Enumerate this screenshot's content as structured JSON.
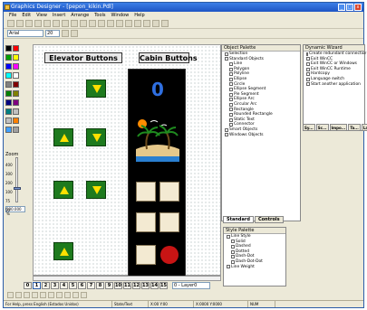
{
  "window": {
    "title": "Graphics Designer - [pepon_kikin.Pdl]",
    "controls": [
      "_",
      "□",
      "x"
    ]
  },
  "menu": [
    "File",
    "Edit",
    "View",
    "Insert",
    "Arrange",
    "Tools",
    "Window",
    "Help"
  ],
  "font_bar": {
    "font": "Arial",
    "size": "20"
  },
  "canvas": {
    "elevator_header": "Elevator Buttons",
    "cabin_header": "Cabin Buttons",
    "cabin_floor_indicator": "0"
  },
  "zoom": {
    "ticks": [
      "400",
      "300",
      "200",
      "100",
      "75",
      "50"
    ],
    "value": "100.000 %",
    "label": "Zoom"
  },
  "layers": {
    "tabs": [
      "0",
      "1",
      "2",
      "3",
      "4",
      "5",
      "6",
      "7",
      "8",
      "9",
      "10",
      "11",
      "12",
      "13",
      "14",
      "15"
    ],
    "combo": "0 - Layer0"
  },
  "object_palette": {
    "title": "Object Palette",
    "items": [
      {
        "label": "Selection",
        "level": 0
      },
      {
        "label": "Standard Objects",
        "level": 0
      },
      {
        "label": "Line",
        "level": 1
      },
      {
        "label": "Polygon",
        "level": 1
      },
      {
        "label": "Polyline",
        "level": 1
      },
      {
        "label": "Ellipse",
        "level": 1
      },
      {
        "label": "Circle",
        "level": 1
      },
      {
        "label": "Ellipse Segment",
        "level": 1
      },
      {
        "label": "Pie Segment",
        "level": 1
      },
      {
        "label": "Ellipse Arc",
        "level": 1
      },
      {
        "label": "Circular Arc",
        "level": 1
      },
      {
        "label": "Rectangle",
        "level": 1
      },
      {
        "label": "Rounded Rectangle",
        "level": 1
      },
      {
        "label": "Static Text",
        "level": 1
      },
      {
        "label": "Connector",
        "level": 1
      },
      {
        "label": "Smart Objects",
        "level": 0
      },
      {
        "label": "Windows Objects",
        "level": 0
      }
    ],
    "tabs": [
      "Standard",
      "Controls"
    ]
  },
  "dynamic_wizard": {
    "title": "Dynamic Wizard",
    "items": [
      "Create redundant connectior",
      "Exit WinCC",
      "Exit WinCC or Windows",
      "Exit WinCC Runtime",
      "Hardcopy",
      "Language switch",
      "Start another application"
    ],
    "tabs": [
      "Sy...",
      "Sc...",
      "Impo...",
      "Ta...",
      "Labl..."
    ]
  },
  "style_palette": {
    "title": "Style Palette",
    "items": [
      {
        "label": "Line Style",
        "level": 0
      },
      {
        "label": "Solid",
        "level": 1
      },
      {
        "label": "Dashed",
        "level": 1
      },
      {
        "label": "Dotted",
        "level": 1
      },
      {
        "label": "Dash-Dot",
        "level": 1
      },
      {
        "label": "Dash-Dot-Dot",
        "level": 1
      },
      {
        "label": "Line Weight",
        "level": 0
      }
    ]
  },
  "status": [
    "For Help, press  English (Estados Unidos)",
    "State/Text",
    "X:00  Y:00",
    "X:0000 Y:0000",
    "NUM"
  ],
  "colors": {
    "elevator_button": "#1e7a1e",
    "arrow": "#ffe000",
    "cabin_bg": "#000000",
    "floor_indicator": "#2f6fe0",
    "alarm": "#c81414",
    "titlebar": "#1d55c4"
  },
  "palette_colors": [
    "#000000",
    "#ff0000",
    "#00a000",
    "#ffff00",
    "#0000ff",
    "#ff00ff",
    "#00ffff",
    "#ffffff",
    "#808080",
    "#800000",
    "#008000",
    "#808000",
    "#000080",
    "#800080",
    "#008080",
    "#c0c0c0",
    "#c0c0c0",
    "#ff8000",
    "#40a0ff",
    "#a0a0a0"
  ]
}
